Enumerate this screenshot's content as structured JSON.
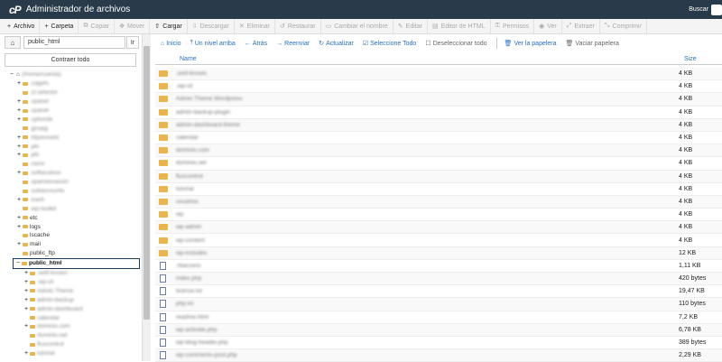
{
  "header": {
    "logo": "cP",
    "title": "Administrador de archivos",
    "search_label": "Buscar"
  },
  "toolbar": [
    {
      "icon": "+",
      "label": "Archivo",
      "enabled": true
    },
    {
      "icon": "+",
      "label": "Carpeta",
      "enabled": true
    },
    {
      "icon": "⧉",
      "label": "Copiar",
      "enabled": false
    },
    {
      "icon": "✥",
      "label": "Mover",
      "enabled": false
    },
    {
      "icon": "⇧",
      "label": "Cargar",
      "enabled": true
    },
    {
      "icon": "⇩",
      "label": "Descargar",
      "enabled": false
    },
    {
      "icon": "✕",
      "label": "Eliminar",
      "enabled": false
    },
    {
      "icon": "↺",
      "label": "Restaurar",
      "enabled": false
    },
    {
      "icon": "▭",
      "label": "Cambiar el nombre",
      "enabled": false
    },
    {
      "icon": "✎",
      "label": "Editar",
      "enabled": false
    },
    {
      "icon": "▤",
      "label": "Editor de HTML",
      "enabled": false
    },
    {
      "icon": "⚿",
      "label": "Permisos",
      "enabled": false
    },
    {
      "icon": "◉",
      "label": "Ver",
      "enabled": false
    },
    {
      "icon": "⤢",
      "label": "Extraer",
      "enabled": false
    },
    {
      "icon": "⤡",
      "label": "Comprimir",
      "enabled": false
    }
  ],
  "left": {
    "path_value": "public_html",
    "go_label": "Ir",
    "collapse_label": "Contraer todo"
  },
  "tree": [
    {
      "indent": 0,
      "tog": "−",
      "icon": "home",
      "label": "(/home/cuenta)",
      "blur": true
    },
    {
      "indent": 1,
      "tog": "+",
      "label": ".cagefs",
      "blur": true
    },
    {
      "indent": 1,
      "tog": "",
      "label": ".cl.selector",
      "blur": true
    },
    {
      "indent": 1,
      "tog": "+",
      "label": ".cpanel",
      "blur": true
    },
    {
      "indent": 1,
      "tog": "+",
      "label": ".cpanel",
      "blur": true
    },
    {
      "indent": 1,
      "tog": "+",
      "label": ".cphorde",
      "blur": true
    },
    {
      "indent": 1,
      "tog": "",
      "label": ".gnupg",
      "blur": true
    },
    {
      "indent": 1,
      "tog": "+",
      "label": ".htpasswds",
      "blur": true
    },
    {
      "indent": 1,
      "tog": "+",
      "label": ".pki",
      "blur": true
    },
    {
      "indent": 1,
      "tog": "+",
      "label": ".pki",
      "blur": true
    },
    {
      "indent": 1,
      "tog": "",
      "label": ".razor",
      "blur": true
    },
    {
      "indent": 1,
      "tog": "+",
      "label": ".softaculous",
      "blur": true
    },
    {
      "indent": 1,
      "tog": "",
      "label": ".spamassassin",
      "blur": true
    },
    {
      "indent": 1,
      "tog": "",
      "label": ".subaccounts",
      "blur": true
    },
    {
      "indent": 1,
      "tog": "+",
      "label": ".trash",
      "blur": true
    },
    {
      "indent": 1,
      "tog": "",
      "label": ".wp-toolkit",
      "blur": true
    },
    {
      "indent": 1,
      "tog": "+",
      "label": "etc",
      "blur": false
    },
    {
      "indent": 1,
      "tog": "+",
      "label": "logs",
      "blur": false
    },
    {
      "indent": 1,
      "tog": "",
      "label": "lscache",
      "blur": false
    },
    {
      "indent": 1,
      "tog": "+",
      "label": "mail",
      "blur": false
    },
    {
      "indent": 1,
      "tog": "",
      "label": "public_ftp",
      "blur": false
    },
    {
      "indent": 1,
      "tog": "−",
      "label": "public_html",
      "blur": false,
      "selected": true
    },
    {
      "indent": 2,
      "tog": "+",
      "label": ".well-known",
      "blur": true
    },
    {
      "indent": 2,
      "tog": "+",
      "label": ".wp-cli",
      "blur": true
    },
    {
      "indent": 2,
      "tog": "+",
      "label": "Admin Theme",
      "blur": true
    },
    {
      "indent": 2,
      "tog": "+",
      "label": "admin-backup",
      "blur": true
    },
    {
      "indent": 2,
      "tog": "+",
      "label": "admin-dashboard",
      "blur": true
    },
    {
      "indent": 2,
      "tog": "",
      "label": "calendar",
      "blur": true
    },
    {
      "indent": 2,
      "tog": "+",
      "label": "dominio.com",
      "blur": true
    },
    {
      "indent": 2,
      "tog": "",
      "label": "dominio.net",
      "blur": true
    },
    {
      "indent": 2,
      "tog": "",
      "label": "fluxcontrol",
      "blur": true
    },
    {
      "indent": 2,
      "tog": "+",
      "label": "tutorial",
      "blur": true
    }
  ],
  "actions": [
    {
      "icon": "⌂",
      "label": "Inicio"
    },
    {
      "icon": "⤒",
      "label": "Un nivel arriba"
    },
    {
      "icon": "←",
      "label": "Atrás"
    },
    {
      "icon": "→",
      "label": "Reenviar"
    },
    {
      "icon": "↻",
      "label": "Actualizar"
    },
    {
      "icon": "☑",
      "label": "Seleccione Todo"
    },
    {
      "icon": "☐",
      "label": "Deseleccionar todo",
      "muted": true
    },
    {
      "icon": "🗑",
      "label": "Ver la papelera"
    },
    {
      "icon": "🗑",
      "label": "Vaciar papelera",
      "muted": true
    }
  ],
  "grid": {
    "col_name": "Name",
    "col_size": "Size",
    "rows": [
      {
        "type": "folder",
        "name": ".well-known",
        "size": "4 KB"
      },
      {
        "type": "folder",
        "name": ".wp-cli",
        "size": "4 KB"
      },
      {
        "type": "folder",
        "name": "Admin Theme Wordpress",
        "size": "4 KB"
      },
      {
        "type": "folder",
        "name": "admin-backup-plugin",
        "size": "4 KB"
      },
      {
        "type": "folder",
        "name": "admin-dashboard-theme",
        "size": "4 KB"
      },
      {
        "type": "folder",
        "name": "calendar",
        "size": "4 KB"
      },
      {
        "type": "folder",
        "name": "dominio.com",
        "size": "4 KB"
      },
      {
        "type": "folder",
        "name": "dominio.net",
        "size": "4 KB"
      },
      {
        "type": "folder",
        "name": "fluxcontrol",
        "size": "4 KB"
      },
      {
        "type": "folder",
        "name": "tutorial",
        "size": "4 KB"
      },
      {
        "type": "folder",
        "name": "usuarios",
        "size": "4 KB"
      },
      {
        "type": "folder",
        "name": "wp",
        "size": "4 KB"
      },
      {
        "type": "folder",
        "name": "wp-admin",
        "size": "4 KB"
      },
      {
        "type": "folder",
        "name": "wp-content",
        "size": "4 KB"
      },
      {
        "type": "folder",
        "name": "wp-includes",
        "size": "12 KB"
      },
      {
        "type": "file",
        "name": ".htaccess",
        "size": "1,11 KB"
      },
      {
        "type": "file",
        "name": "index.php",
        "size": "420 bytes"
      },
      {
        "type": "file",
        "name": "license.txt",
        "size": "19,47 KB"
      },
      {
        "type": "file",
        "name": "php.ini",
        "size": "110 bytes"
      },
      {
        "type": "file",
        "name": "readme.html",
        "size": "7,2 KB"
      },
      {
        "type": "file",
        "name": "wp-activate.php",
        "size": "6,78 KB"
      },
      {
        "type": "file",
        "name": "wp-blog-header.php",
        "size": "389 bytes"
      },
      {
        "type": "file",
        "name": "wp-comments-post.php",
        "size": "2,29 KB"
      }
    ]
  }
}
